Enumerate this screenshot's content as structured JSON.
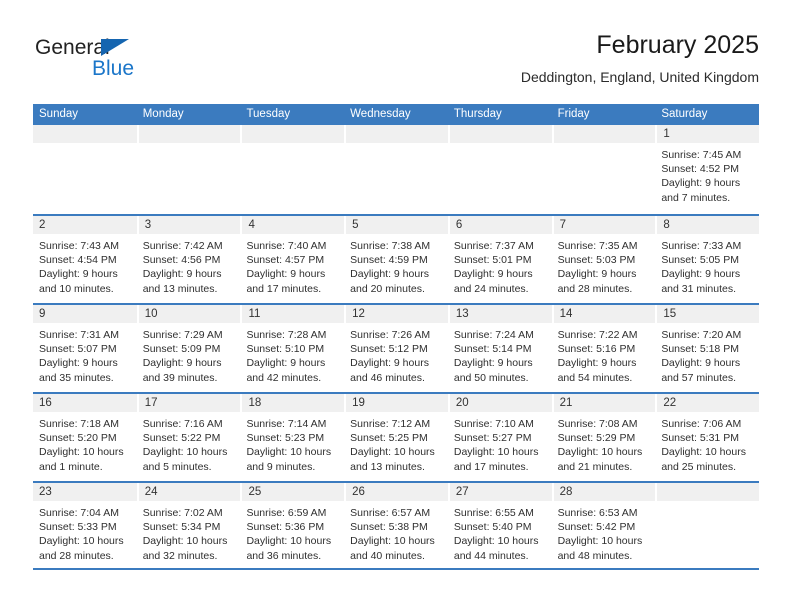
{
  "brand": {
    "name_part1": "General",
    "name_part2": "Blue",
    "triangle_color": "#1565b0",
    "blue_color": "#1b76c9"
  },
  "header": {
    "title": "February 2025",
    "subtitle": "Deddington, England, United Kingdom"
  },
  "theme": {
    "header_blue": "#3b7bbf",
    "daynum_band": "#f0f0f0",
    "text": "#2f2f2f"
  },
  "weekday_headers": [
    "Sunday",
    "Monday",
    "Tuesday",
    "Wednesday",
    "Thursday",
    "Friday",
    "Saturday"
  ],
  "weeks": [
    [
      {
        "day": "",
        "lines": []
      },
      {
        "day": "",
        "lines": []
      },
      {
        "day": "",
        "lines": []
      },
      {
        "day": "",
        "lines": []
      },
      {
        "day": "",
        "lines": []
      },
      {
        "day": "",
        "lines": []
      },
      {
        "day": "1",
        "lines": [
          "Sunrise: 7:45 AM",
          "Sunset: 4:52 PM",
          "Daylight: 9 hours",
          "and 7 minutes."
        ]
      }
    ],
    [
      {
        "day": "2",
        "lines": [
          "Sunrise: 7:43 AM",
          "Sunset: 4:54 PM",
          "Daylight: 9 hours",
          "and 10 minutes."
        ]
      },
      {
        "day": "3",
        "lines": [
          "Sunrise: 7:42 AM",
          "Sunset: 4:56 PM",
          "Daylight: 9 hours",
          "and 13 minutes."
        ]
      },
      {
        "day": "4",
        "lines": [
          "Sunrise: 7:40 AM",
          "Sunset: 4:57 PM",
          "Daylight: 9 hours",
          "and 17 minutes."
        ]
      },
      {
        "day": "5",
        "lines": [
          "Sunrise: 7:38 AM",
          "Sunset: 4:59 PM",
          "Daylight: 9 hours",
          "and 20 minutes."
        ]
      },
      {
        "day": "6",
        "lines": [
          "Sunrise: 7:37 AM",
          "Sunset: 5:01 PM",
          "Daylight: 9 hours",
          "and 24 minutes."
        ]
      },
      {
        "day": "7",
        "lines": [
          "Sunrise: 7:35 AM",
          "Sunset: 5:03 PM",
          "Daylight: 9 hours",
          "and 28 minutes."
        ]
      },
      {
        "day": "8",
        "lines": [
          "Sunrise: 7:33 AM",
          "Sunset: 5:05 PM",
          "Daylight: 9 hours",
          "and 31 minutes."
        ]
      }
    ],
    [
      {
        "day": "9",
        "lines": [
          "Sunrise: 7:31 AM",
          "Sunset: 5:07 PM",
          "Daylight: 9 hours",
          "and 35 minutes."
        ]
      },
      {
        "day": "10",
        "lines": [
          "Sunrise: 7:29 AM",
          "Sunset: 5:09 PM",
          "Daylight: 9 hours",
          "and 39 minutes."
        ]
      },
      {
        "day": "11",
        "lines": [
          "Sunrise: 7:28 AM",
          "Sunset: 5:10 PM",
          "Daylight: 9 hours",
          "and 42 minutes."
        ]
      },
      {
        "day": "12",
        "lines": [
          "Sunrise: 7:26 AM",
          "Sunset: 5:12 PM",
          "Daylight: 9 hours",
          "and 46 minutes."
        ]
      },
      {
        "day": "13",
        "lines": [
          "Sunrise: 7:24 AM",
          "Sunset: 5:14 PM",
          "Daylight: 9 hours",
          "and 50 minutes."
        ]
      },
      {
        "day": "14",
        "lines": [
          "Sunrise: 7:22 AM",
          "Sunset: 5:16 PM",
          "Daylight: 9 hours",
          "and 54 minutes."
        ]
      },
      {
        "day": "15",
        "lines": [
          "Sunrise: 7:20 AM",
          "Sunset: 5:18 PM",
          "Daylight: 9 hours",
          "and 57 minutes."
        ]
      }
    ],
    [
      {
        "day": "16",
        "lines": [
          "Sunrise: 7:18 AM",
          "Sunset: 5:20 PM",
          "Daylight: 10 hours",
          "and 1 minute."
        ]
      },
      {
        "day": "17",
        "lines": [
          "Sunrise: 7:16 AM",
          "Sunset: 5:22 PM",
          "Daylight: 10 hours",
          "and 5 minutes."
        ]
      },
      {
        "day": "18",
        "lines": [
          "Sunrise: 7:14 AM",
          "Sunset: 5:23 PM",
          "Daylight: 10 hours",
          "and 9 minutes."
        ]
      },
      {
        "day": "19",
        "lines": [
          "Sunrise: 7:12 AM",
          "Sunset: 5:25 PM",
          "Daylight: 10 hours",
          "and 13 minutes."
        ]
      },
      {
        "day": "20",
        "lines": [
          "Sunrise: 7:10 AM",
          "Sunset: 5:27 PM",
          "Daylight: 10 hours",
          "and 17 minutes."
        ]
      },
      {
        "day": "21",
        "lines": [
          "Sunrise: 7:08 AM",
          "Sunset: 5:29 PM",
          "Daylight: 10 hours",
          "and 21 minutes."
        ]
      },
      {
        "day": "22",
        "lines": [
          "Sunrise: 7:06 AM",
          "Sunset: 5:31 PM",
          "Daylight: 10 hours",
          "and 25 minutes."
        ]
      }
    ],
    [
      {
        "day": "23",
        "lines": [
          "Sunrise: 7:04 AM",
          "Sunset: 5:33 PM",
          "Daylight: 10 hours",
          "and 28 minutes."
        ]
      },
      {
        "day": "24",
        "lines": [
          "Sunrise: 7:02 AM",
          "Sunset: 5:34 PM",
          "Daylight: 10 hours",
          "and 32 minutes."
        ]
      },
      {
        "day": "25",
        "lines": [
          "Sunrise: 6:59 AM",
          "Sunset: 5:36 PM",
          "Daylight: 10 hours",
          "and 36 minutes."
        ]
      },
      {
        "day": "26",
        "lines": [
          "Sunrise: 6:57 AM",
          "Sunset: 5:38 PM",
          "Daylight: 10 hours",
          "and 40 minutes."
        ]
      },
      {
        "day": "27",
        "lines": [
          "Sunrise: 6:55 AM",
          "Sunset: 5:40 PM",
          "Daylight: 10 hours",
          "and 44 minutes."
        ]
      },
      {
        "day": "28",
        "lines": [
          "Sunrise: 6:53 AM",
          "Sunset: 5:42 PM",
          "Daylight: 10 hours",
          "and 48 minutes."
        ]
      },
      {
        "day": "",
        "lines": []
      }
    ]
  ]
}
